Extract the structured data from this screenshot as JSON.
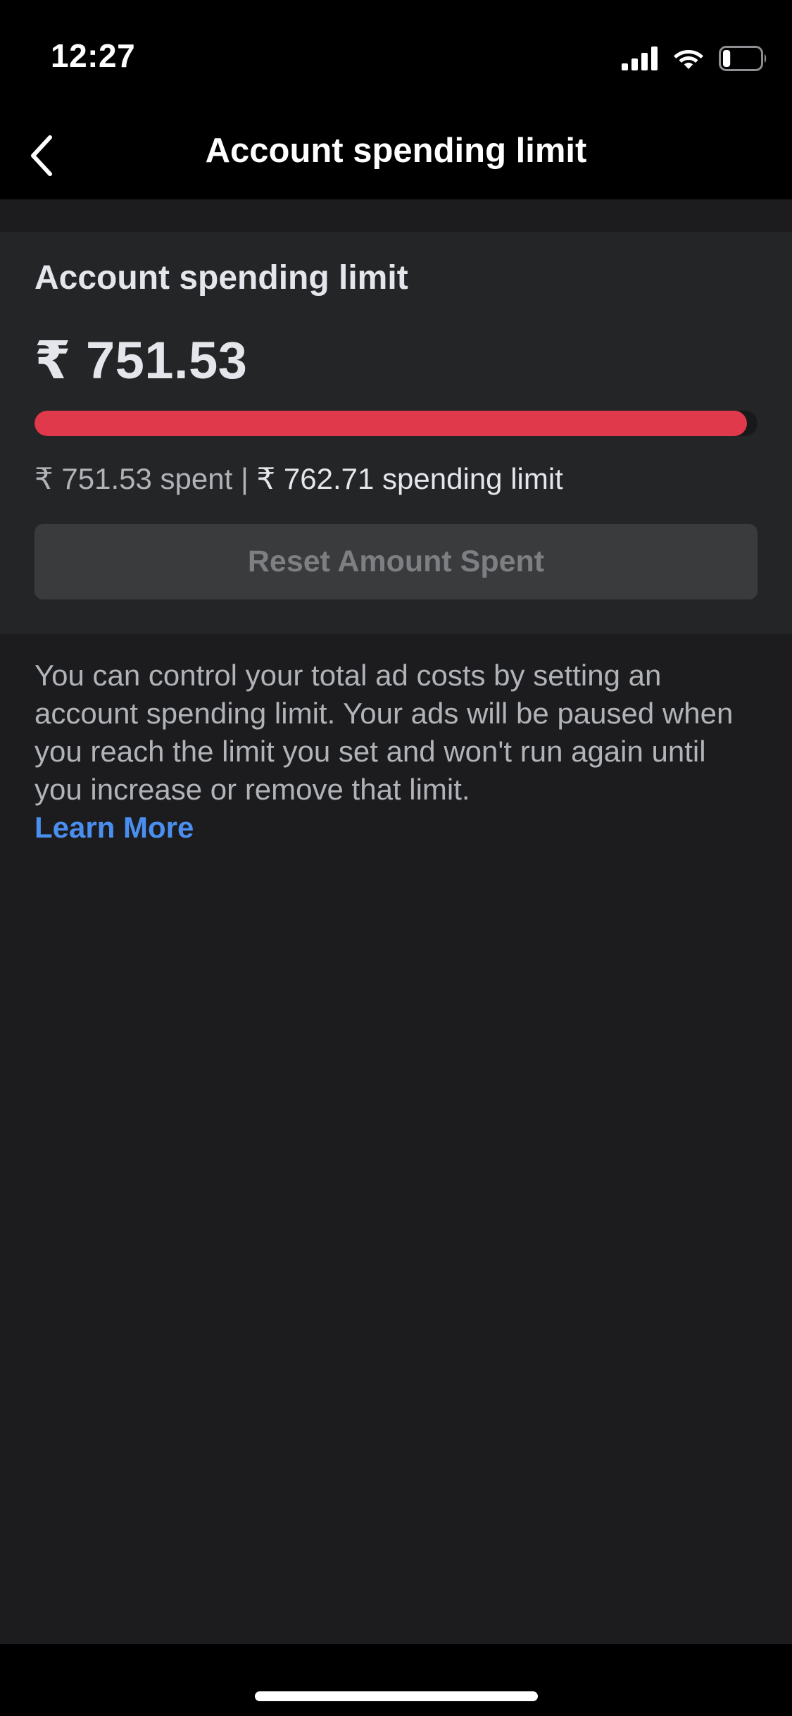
{
  "status_bar": {
    "time": "12:27",
    "icons": [
      "cellular-signal-icon",
      "wifi-icon",
      "battery-icon"
    ],
    "battery_level": 0.2
  },
  "nav": {
    "back_icon": "chevron-left-icon",
    "title": "Account spending limit"
  },
  "card": {
    "heading": "Account spending limit",
    "amount_spent_display": "₹ 751.53",
    "spent_amount": 751.53,
    "limit_amount": 762.71,
    "progress_color": "#e0394b",
    "spent_text": "₹ 751.53 spent",
    "separator": "|",
    "limit_text": "₹ 762.71 spending limit",
    "reset_label": "Reset Amount Spent"
  },
  "description": {
    "text": "You can control your total ad costs by setting an account spending limit. Your ads will be paused when you reach the limit you set and won't run again until you increase or remove that limit.",
    "link_label": "Learn More",
    "link_color": "#4a8ff0"
  },
  "colors": {
    "background": "#1c1c1e",
    "card": "#242526",
    "bars": "#000000"
  }
}
